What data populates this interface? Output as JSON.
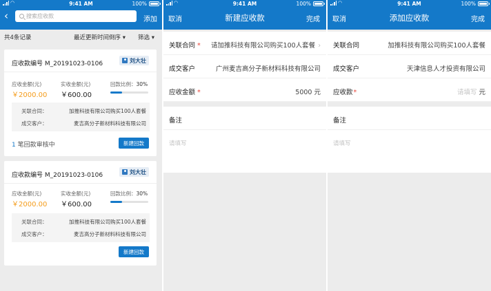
{
  "status_bar": {
    "time": "9:41 AM",
    "battery": "100%"
  },
  "list_screen": {
    "search_placeholder": "搜索应收款",
    "add_label": "添加",
    "record_count": "共4条记录",
    "sort_label": "最近更新时间倒序",
    "filter_label": "筛选",
    "cards": [
      {
        "number": "应收款编号 M_20191023-0106",
        "owner": "刘大壮",
        "receivable_label": "应收金额(元)",
        "receivable_value": "￥2000.00",
        "received_label": "实收金额(元)",
        "received_value": "￥600.00",
        "ratio_label": "回款比例：",
        "ratio_value": "30%",
        "ratio": 0.3,
        "contract_label": "关联合同：",
        "contract_value": "加推科技有限公司购买100人套餐",
        "customer_label": "成交客户：",
        "customer_value": "麦吉高分子新材料科技有限公司",
        "pending_count": "1",
        "pending_text": " 笔回款审核中",
        "button_label": "新建回款"
      },
      {
        "number": "应收款编号 M_20191023-0106",
        "owner": "刘大壮",
        "receivable_label": "应收金额(元)",
        "receivable_value": "￥2000.00",
        "received_label": "实收金额(元)",
        "received_value": "￥600.00",
        "ratio_label": "回款比例：",
        "ratio_value": "30%",
        "ratio": 0.3,
        "contract_label": "关联合同：",
        "contract_value": "加推科技有限公司购买100人套餐",
        "customer_label": "成交客户：",
        "customer_value": "麦吉高分子新材料科技有限公司",
        "button_label": "新建回款"
      }
    ]
  },
  "new_screen": {
    "cancel": "取消",
    "title": "新建应收款",
    "done": "完成",
    "contract_label": "关联合同",
    "contract_value": "请加推科技有限公司购买100人套餐",
    "customer_label": "成交客户",
    "customer_value": "广州麦吉高分子新材料科技有限公司",
    "amount_label": "应收金额",
    "amount_value": "5000 元",
    "remark_label": "备注",
    "remark_placeholder": "请填写"
  },
  "add_screen": {
    "cancel": "取消",
    "title": "添加应收款",
    "done": "完成",
    "contract_label": "关联合同",
    "contract_value": "加推科技有限公司购买100人套餐",
    "customer_label": "成交客户",
    "customer_value": "天津信息人才投资有限公司",
    "amount_label": "应收款",
    "amount_placeholder": "请填写",
    "amount_unit": "元",
    "remark_label": "备注",
    "remark_placeholder": "请填写"
  },
  "colors": {
    "primary": "#1479c9",
    "accent": "#f49b19",
    "required": "#e8463a"
  }
}
